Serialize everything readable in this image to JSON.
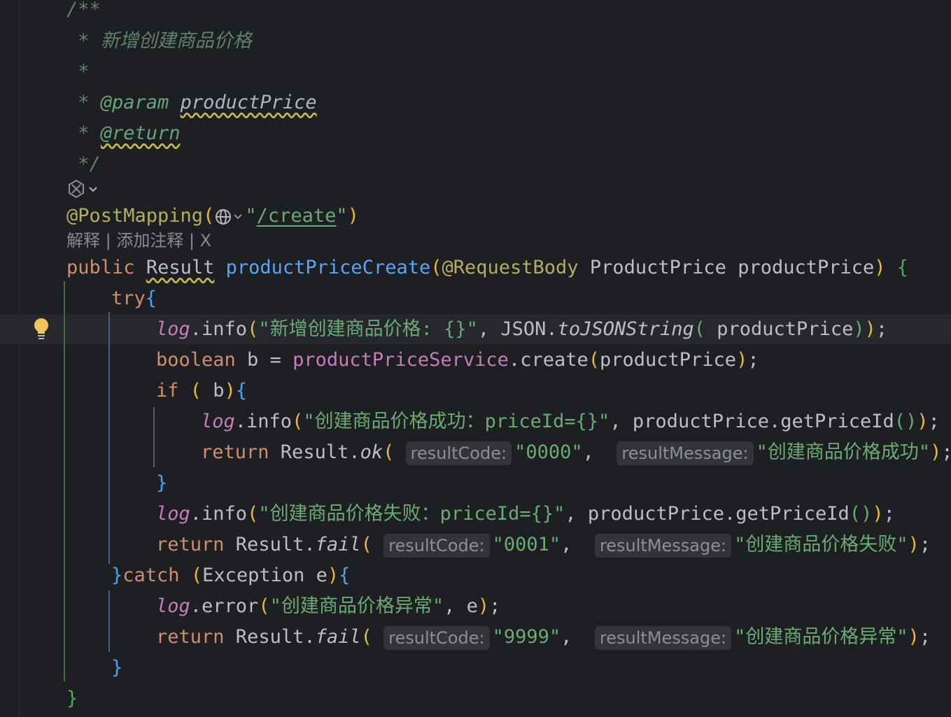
{
  "editor": {
    "doc": {
      "open": "/**",
      "desc_star": " * ",
      "desc": "新增创建商品价格",
      "blank": " *",
      "param_star": " * ",
      "param_tag": "@param",
      "param_sp": " ",
      "param_name": "productPrice",
      "return_star": " * ",
      "return_tag": "@return",
      "close": " */"
    },
    "mapping": {
      "at": "@PostMapping",
      "open_paren": "(",
      "q1": "\"",
      "path": "/create",
      "q2": "\"",
      "close_paren": ")"
    },
    "code_lens": "解释 | 添加注释 | X",
    "sig": {
      "public": "public",
      "result": "Result",
      "name": "productPriceCreate",
      "open": "(",
      "annotation": "@RequestBody",
      "type": "ProductPrice",
      "param": "productPrice",
      "close": ")",
      "brace": "{"
    },
    "try": "try",
    "line_log1": {
      "log": "log",
      "dot_info": ".info",
      "op": "(",
      "str": "\"新增创建商品价格: {}\"",
      "comma": ", JSON.",
      "method": "toJSONString",
      "op2": "(",
      "arg": " productPrice",
      "cp2": ")",
      "cp": ")",
      "semi": ";"
    },
    "line_bool": {
      "kw": "boolean",
      "mid": " b = ",
      "svc": "productPriceService",
      "call": ".create",
      "op": "(",
      "arg": "productPrice",
      "cp": ")",
      "semi": ";"
    },
    "line_if": {
      "kw": "if",
      "sp": " ",
      "op": "(",
      "b": " b",
      "cp": ")",
      "brace": "{"
    },
    "line_log2": {
      "log": "log",
      "dot_info": ".info",
      "op": "(",
      "str": "\"创建商品价格成功：priceId={}\"",
      "rest": ", productPrice.getPriceId",
      "op2": "(",
      "cp2": ")",
      "cp": ")",
      "semi": ";"
    },
    "line_ret_ok": {
      "kw": "return",
      "obj": " Result.",
      "method": "ok",
      "op": "(",
      "hint1": "resultCode:",
      "val1": "\"0000\"",
      "comma": ", ",
      "hint2": "resultMessage:",
      "val2": "\"创建商品价格成功\"",
      "cp": ")",
      "semi": ";"
    },
    "close_if": "}",
    "line_log3": {
      "log": "log",
      "dot_info": ".info",
      "op": "(",
      "str": "\"创建商品价格失败：priceId={}\"",
      "rest": ", productPrice.getPriceId",
      "op2": "(",
      "cp2": ")",
      "cp": ")",
      "semi": ";"
    },
    "line_ret_fail1": {
      "kw": "return",
      "obj": " Result.",
      "method": "fail",
      "op": "(",
      "hint1": "resultCode:",
      "val1": "\"0001\"",
      "comma": ", ",
      "hint2": "resultMessage:",
      "val2": "\"创建商品价格失败\"",
      "cp": ")",
      "semi": ";"
    },
    "line_catch": {
      "brace1": "}",
      "kw": "catch",
      "sp": " ",
      "op": "(",
      "type": "Exception e",
      "cp": ")",
      "brace2": "{"
    },
    "line_log_err": {
      "log": "log",
      "dot": ".error",
      "op": "(",
      "str": "\"创建商品价格异常\"",
      "rest": ", e",
      "cp": ")",
      "semi": ";"
    },
    "line_ret_fail2": {
      "kw": "return",
      "obj": " Result.",
      "method": "fail",
      "op": "(",
      "hint1": "resultCode:",
      "val1": "\"9999\"",
      "comma": ", ",
      "hint2": "resultMessage:",
      "val2": "\"创建商品价格异常\"",
      "cp": ")",
      "semi": ";"
    },
    "close_catch": "}",
    "close_method": "}"
  },
  "icons": {
    "bulb": "lightbulb-icon",
    "ai": "ai-assistant-icon",
    "globe": "globe-icon"
  },
  "colors": {
    "background": "#1e1f22",
    "keyword": "#cf8e6d",
    "string": "#6aab73",
    "function": "#56a8f5",
    "field": "#c77dbb",
    "annotation": "#b3ae60",
    "comment": "#5f826b"
  }
}
